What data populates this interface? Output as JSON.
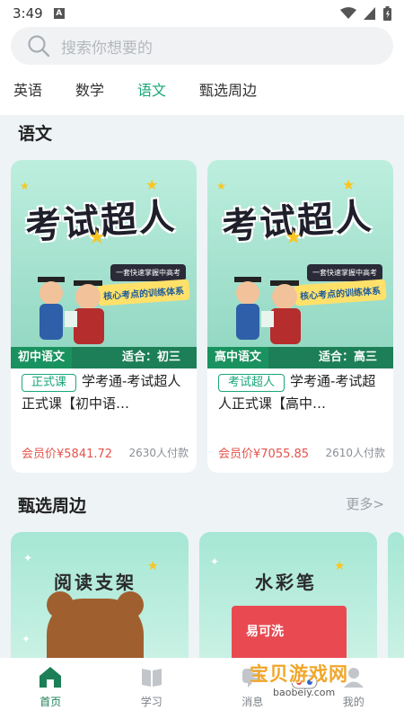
{
  "status_bar": {
    "time": "3:49",
    "notif_icon": "A"
  },
  "search": {
    "placeholder": "搜索你想要的"
  },
  "tabs": [
    {
      "label": "英语"
    },
    {
      "label": "数学"
    },
    {
      "label": "语文",
      "active": true
    },
    {
      "label": "甄选周边"
    }
  ],
  "section_course": {
    "title": "语文"
  },
  "cards": [
    {
      "poster_title": "考试超人",
      "poster_tag1": "一套快速掌握中高考",
      "poster_tag2": "核心考点的训练体系",
      "grade_tag": "初中语文",
      "fit_label": "适合：初三",
      "badge": "正式课",
      "title": "学考通-考试超人正式课【初中语…",
      "price": "会员价¥5841.72",
      "buyers": "2630人付款"
    },
    {
      "poster_title": "考试超人",
      "poster_tag1": "一套快速掌握中高考",
      "poster_tag2": "核心考点的训练体系",
      "grade_tag": "高中语文",
      "fit_label": "适合：高三",
      "badge": "考试超人",
      "title": "学考通-考试超人正式课【高中…",
      "price": "会员价¥7055.85",
      "buyers": "2610人付款"
    }
  ],
  "section_goods": {
    "title": "甄选周边",
    "more": "更多>"
  },
  "goods": [
    {
      "title": "阅读支架"
    },
    {
      "title": "水彩笔",
      "box_text": "易可洗"
    }
  ],
  "bottom_nav": [
    {
      "label": "首页",
      "icon": "home-icon",
      "active": true
    },
    {
      "label": "学习",
      "icon": "book-icon"
    },
    {
      "label": "消息",
      "icon": "message-icon"
    },
    {
      "label": "我的",
      "icon": "user-icon"
    }
  ],
  "watermark": {
    "text": "宝贝游戏网",
    "url": "baobeiy.com"
  },
  "colors": {
    "accent": "#1aa67a",
    "price": "#e5534b",
    "banner": "#1d7f57"
  }
}
